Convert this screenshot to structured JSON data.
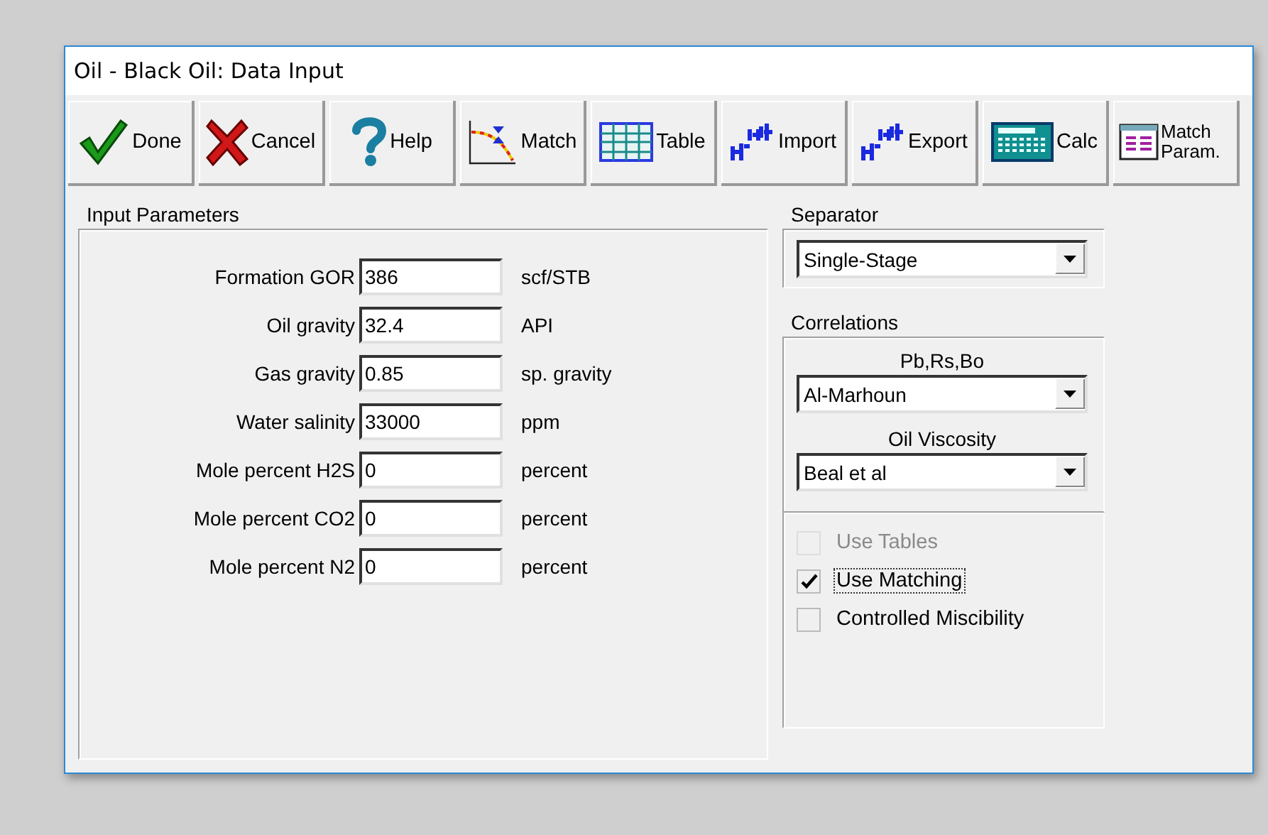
{
  "window": {
    "title": "Oil - Black Oil: Data Input"
  },
  "toolbar": [
    {
      "kind": "done",
      "label": "Done"
    },
    {
      "kind": "cancel",
      "label": "Cancel"
    },
    {
      "kind": "help",
      "label": "Help"
    },
    {
      "kind": "match",
      "label": "Match"
    },
    {
      "kind": "table",
      "label": "Table"
    },
    {
      "kind": "import",
      "label": "Import"
    },
    {
      "kind": "export",
      "label": "Export"
    },
    {
      "kind": "calc",
      "label": "Calc"
    },
    {
      "kind": "params",
      "label": "Match Param."
    }
  ],
  "input_parameters": {
    "title": "Input Parameters",
    "rows": [
      {
        "label": "Formation GOR",
        "value": "386",
        "unit": "scf/STB"
      },
      {
        "label": "Oil gravity",
        "value": "32.4",
        "unit": "API"
      },
      {
        "label": "Gas gravity",
        "value": "0.85",
        "unit": "sp. gravity"
      },
      {
        "label": "Water salinity",
        "value": "33000",
        "unit": "ppm"
      },
      {
        "label": "Mole percent H2S",
        "value": "0",
        "unit": "percent"
      },
      {
        "label": "Mole percent CO2",
        "value": "0",
        "unit": "percent"
      },
      {
        "label": "Mole percent N2",
        "value": "0",
        "unit": "percent"
      }
    ]
  },
  "separator": {
    "title": "Separator",
    "value": "Single-Stage"
  },
  "correlations": {
    "title": "Correlations",
    "selects": [
      {
        "label": "Pb,Rs,Bo",
        "value": "Al-Marhoun"
      },
      {
        "label": "Oil Viscosity",
        "value": "Beal et al"
      }
    ]
  },
  "options": [
    {
      "label": "Use Tables",
      "checked": false,
      "disabled": true,
      "focused": false
    },
    {
      "label": "Use Matching",
      "checked": true,
      "disabled": false,
      "focused": true
    },
    {
      "label": "Controlled Miscibility",
      "checked": false,
      "disabled": false,
      "focused": false
    }
  ]
}
